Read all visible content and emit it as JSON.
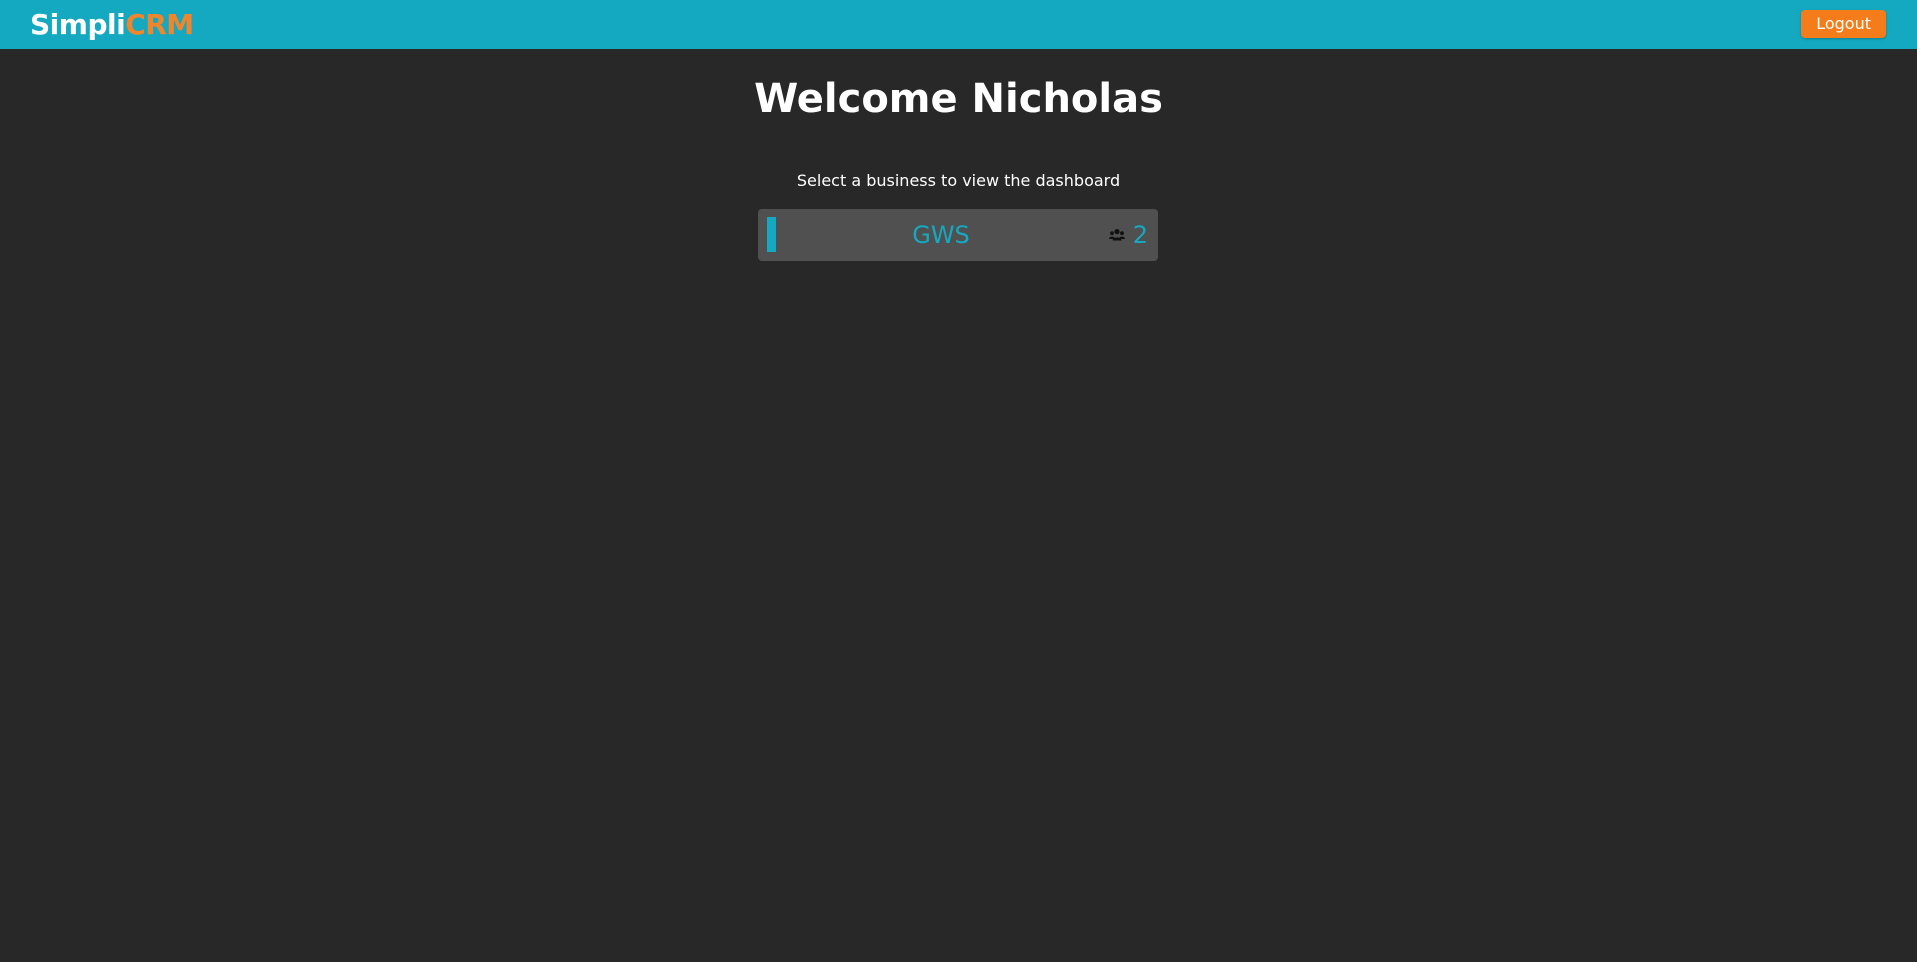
{
  "header": {
    "brand_part1": "Simpli",
    "brand_part2": "CRM",
    "logout_label": "Logout"
  },
  "main": {
    "welcome_title": "Welcome Nicholas",
    "subtitle": "Select a business to view the dashboard",
    "businesses": [
      {
        "name": "GWS",
        "user_count": "2",
        "icon": "users-icon"
      }
    ]
  },
  "colors": {
    "header_bg": "#14a9c1",
    "page_bg": "#282828",
    "brand_accent": "#f0852a",
    "logout_bg": "#f47c1a",
    "card_bg": "#505050",
    "card_text": "#14a9c1"
  }
}
